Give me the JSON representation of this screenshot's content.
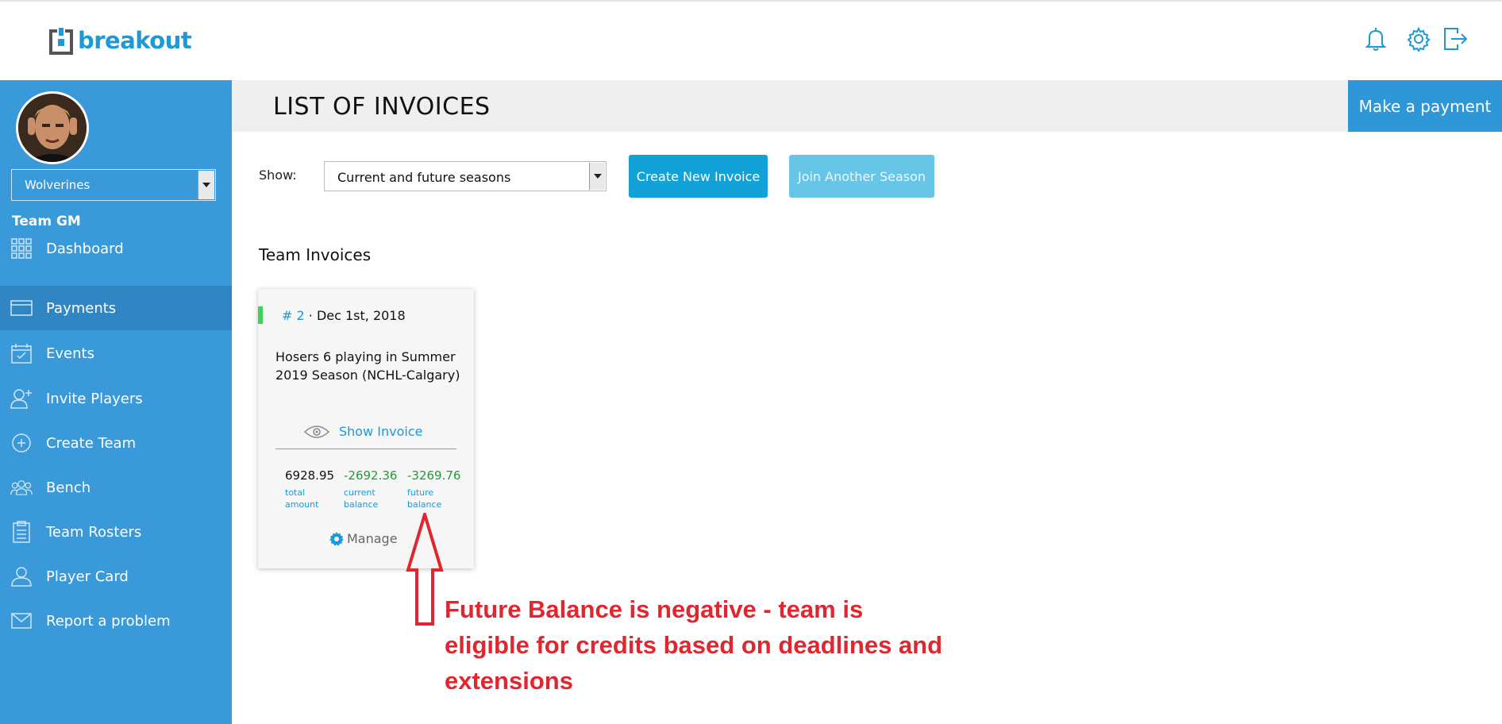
{
  "app": {
    "logo_text": "breakout",
    "brand_color": "#1b9ad6",
    "sidebar_color": "#3a9ad9"
  },
  "header": {
    "icons": [
      "bell-icon",
      "gear-icon",
      "logout-icon"
    ]
  },
  "sidebar": {
    "team_select": "Wolverines",
    "role": "Team GM",
    "items": [
      {
        "label": "Dashboard",
        "icon": "grid-icon"
      },
      {
        "label": "Payments",
        "icon": "card-icon",
        "active": true
      },
      {
        "label": "Events",
        "icon": "calendar-icon"
      },
      {
        "label": "Invite Players",
        "icon": "user-plus-icon"
      },
      {
        "label": "Create Team",
        "icon": "plus-circle-icon"
      },
      {
        "label": "Bench",
        "icon": "users-icon"
      },
      {
        "label": "Team Rosters",
        "icon": "clipboard-icon"
      },
      {
        "label": "Player Card",
        "icon": "user-icon"
      },
      {
        "label": "Report a problem",
        "icon": "envelope-icon"
      }
    ]
  },
  "page": {
    "title": "LIST OF INVOICES",
    "make_payment": "Make a payment",
    "show_label": "Show:",
    "season_filter": "Current and future seasons",
    "create_invoice": "Create New Invoice",
    "join_season": "Join Another Season",
    "section_title": "Team Invoices"
  },
  "invoice": {
    "number": "# 2",
    "date": "· Dec 1st, 2018",
    "description": "Hosers 6 playing in Summer 2019 Season (NCHL-Calgary)",
    "show_invoice": "Show Invoice",
    "total_amount": "6928.95",
    "total_label": "total amount",
    "current_balance": "-2692.36",
    "current_label": "current balance",
    "future_balance": "-3269.76",
    "future_label": "future balance",
    "manage": "Manage",
    "status_color": "#3fd25a"
  },
  "annotation": {
    "text": "Future Balance is negative - team is eligible for credits based on deadlines and extensions",
    "color": "#e0262f"
  }
}
